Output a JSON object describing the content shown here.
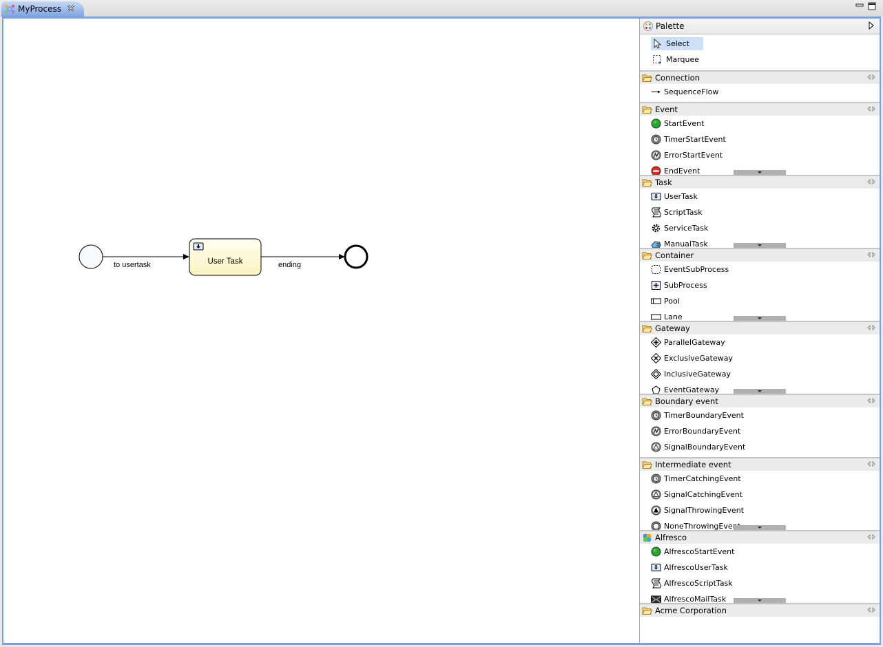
{
  "editor": {
    "tab_title": "MyProcess",
    "close_glyph": "✕"
  },
  "diagram": {
    "start_event": {
      "type": "start-event"
    },
    "flow1": {
      "label": "to usertask"
    },
    "user_task": {
      "label": "User Task"
    },
    "flow2": {
      "label": "ending"
    },
    "end_event": {
      "type": "end-event"
    }
  },
  "palette": {
    "title": "Palette",
    "tools": [
      {
        "label": "Select",
        "icon": "arrow-pointer-icon",
        "selected": true
      },
      {
        "label": "Marquee",
        "icon": "marquee-icon",
        "selected": false
      }
    ],
    "drawers": [
      {
        "title": "Connection",
        "icon": "folder-icon",
        "items": [
          {
            "label": "SequenceFlow",
            "icon": "arrow-right-icon"
          }
        ]
      },
      {
        "title": "Event",
        "icon": "folder-icon",
        "items": [
          {
            "label": "StartEvent",
            "icon": "start-event-icon"
          },
          {
            "label": "TimerStartEvent",
            "icon": "timer-event-icon"
          },
          {
            "label": "ErrorStartEvent",
            "icon": "error-event-icon"
          },
          {
            "label": "EndEvent",
            "icon": "end-event-icon"
          }
        ],
        "more": true
      },
      {
        "title": "Task",
        "icon": "folder-icon",
        "items": [
          {
            "label": "UserTask",
            "icon": "user-task-icon"
          },
          {
            "label": "ScriptTask",
            "icon": "script-task-icon"
          },
          {
            "label": "ServiceTask",
            "icon": "service-task-icon"
          },
          {
            "label": "ManualTask",
            "icon": "manual-task-icon"
          }
        ],
        "more": true
      },
      {
        "title": "Container",
        "icon": "folder-icon",
        "items": [
          {
            "label": "EventSubProcess",
            "icon": "event-subprocess-icon"
          },
          {
            "label": "SubProcess",
            "icon": "subprocess-icon"
          },
          {
            "label": "Pool",
            "icon": "pool-icon"
          },
          {
            "label": "Lane",
            "icon": "lane-icon"
          }
        ],
        "more": true
      },
      {
        "title": "Gateway",
        "icon": "folder-icon",
        "items": [
          {
            "label": "ParallelGateway",
            "icon": "parallel-gateway-icon"
          },
          {
            "label": "ExclusiveGateway",
            "icon": "exclusive-gateway-icon"
          },
          {
            "label": "InclusiveGateway",
            "icon": "inclusive-gateway-icon"
          },
          {
            "label": "EventGateway",
            "icon": "event-gateway-icon"
          }
        ],
        "more": true
      },
      {
        "title": "Boundary event",
        "icon": "folder-icon",
        "items": [
          {
            "label": "TimerBoundaryEvent",
            "icon": "timer-event-icon"
          },
          {
            "label": "ErrorBoundaryEvent",
            "icon": "error-event-icon"
          },
          {
            "label": "SignalBoundaryEvent",
            "icon": "signal-event-icon"
          }
        ],
        "more": false
      },
      {
        "title": "Intermediate event",
        "icon": "folder-icon",
        "items": [
          {
            "label": "TimerCatchingEvent",
            "icon": "timer-event-icon"
          },
          {
            "label": "SignalCatchingEvent",
            "icon": "signal-event-icon"
          },
          {
            "label": "SignalThrowingEvent",
            "icon": "signal-throw-icon"
          },
          {
            "label": "NoneThrowingEvent",
            "icon": "none-throw-icon"
          }
        ],
        "more": true
      },
      {
        "title": "Alfresco",
        "icon": "alfresco-icon",
        "items": [
          {
            "label": "AlfrescoStartEvent",
            "icon": "start-event-icon"
          },
          {
            "label": "AlfrescoUserTask",
            "icon": "user-task-icon"
          },
          {
            "label": "AlfrescoScriptTask",
            "icon": "script-task-icon"
          },
          {
            "label": "AlfrescoMailTask",
            "icon": "mail-task-icon"
          }
        ],
        "more": true
      },
      {
        "title": "Acme Corporation",
        "icon": "folder-icon",
        "items": [],
        "more": false
      }
    ]
  }
}
